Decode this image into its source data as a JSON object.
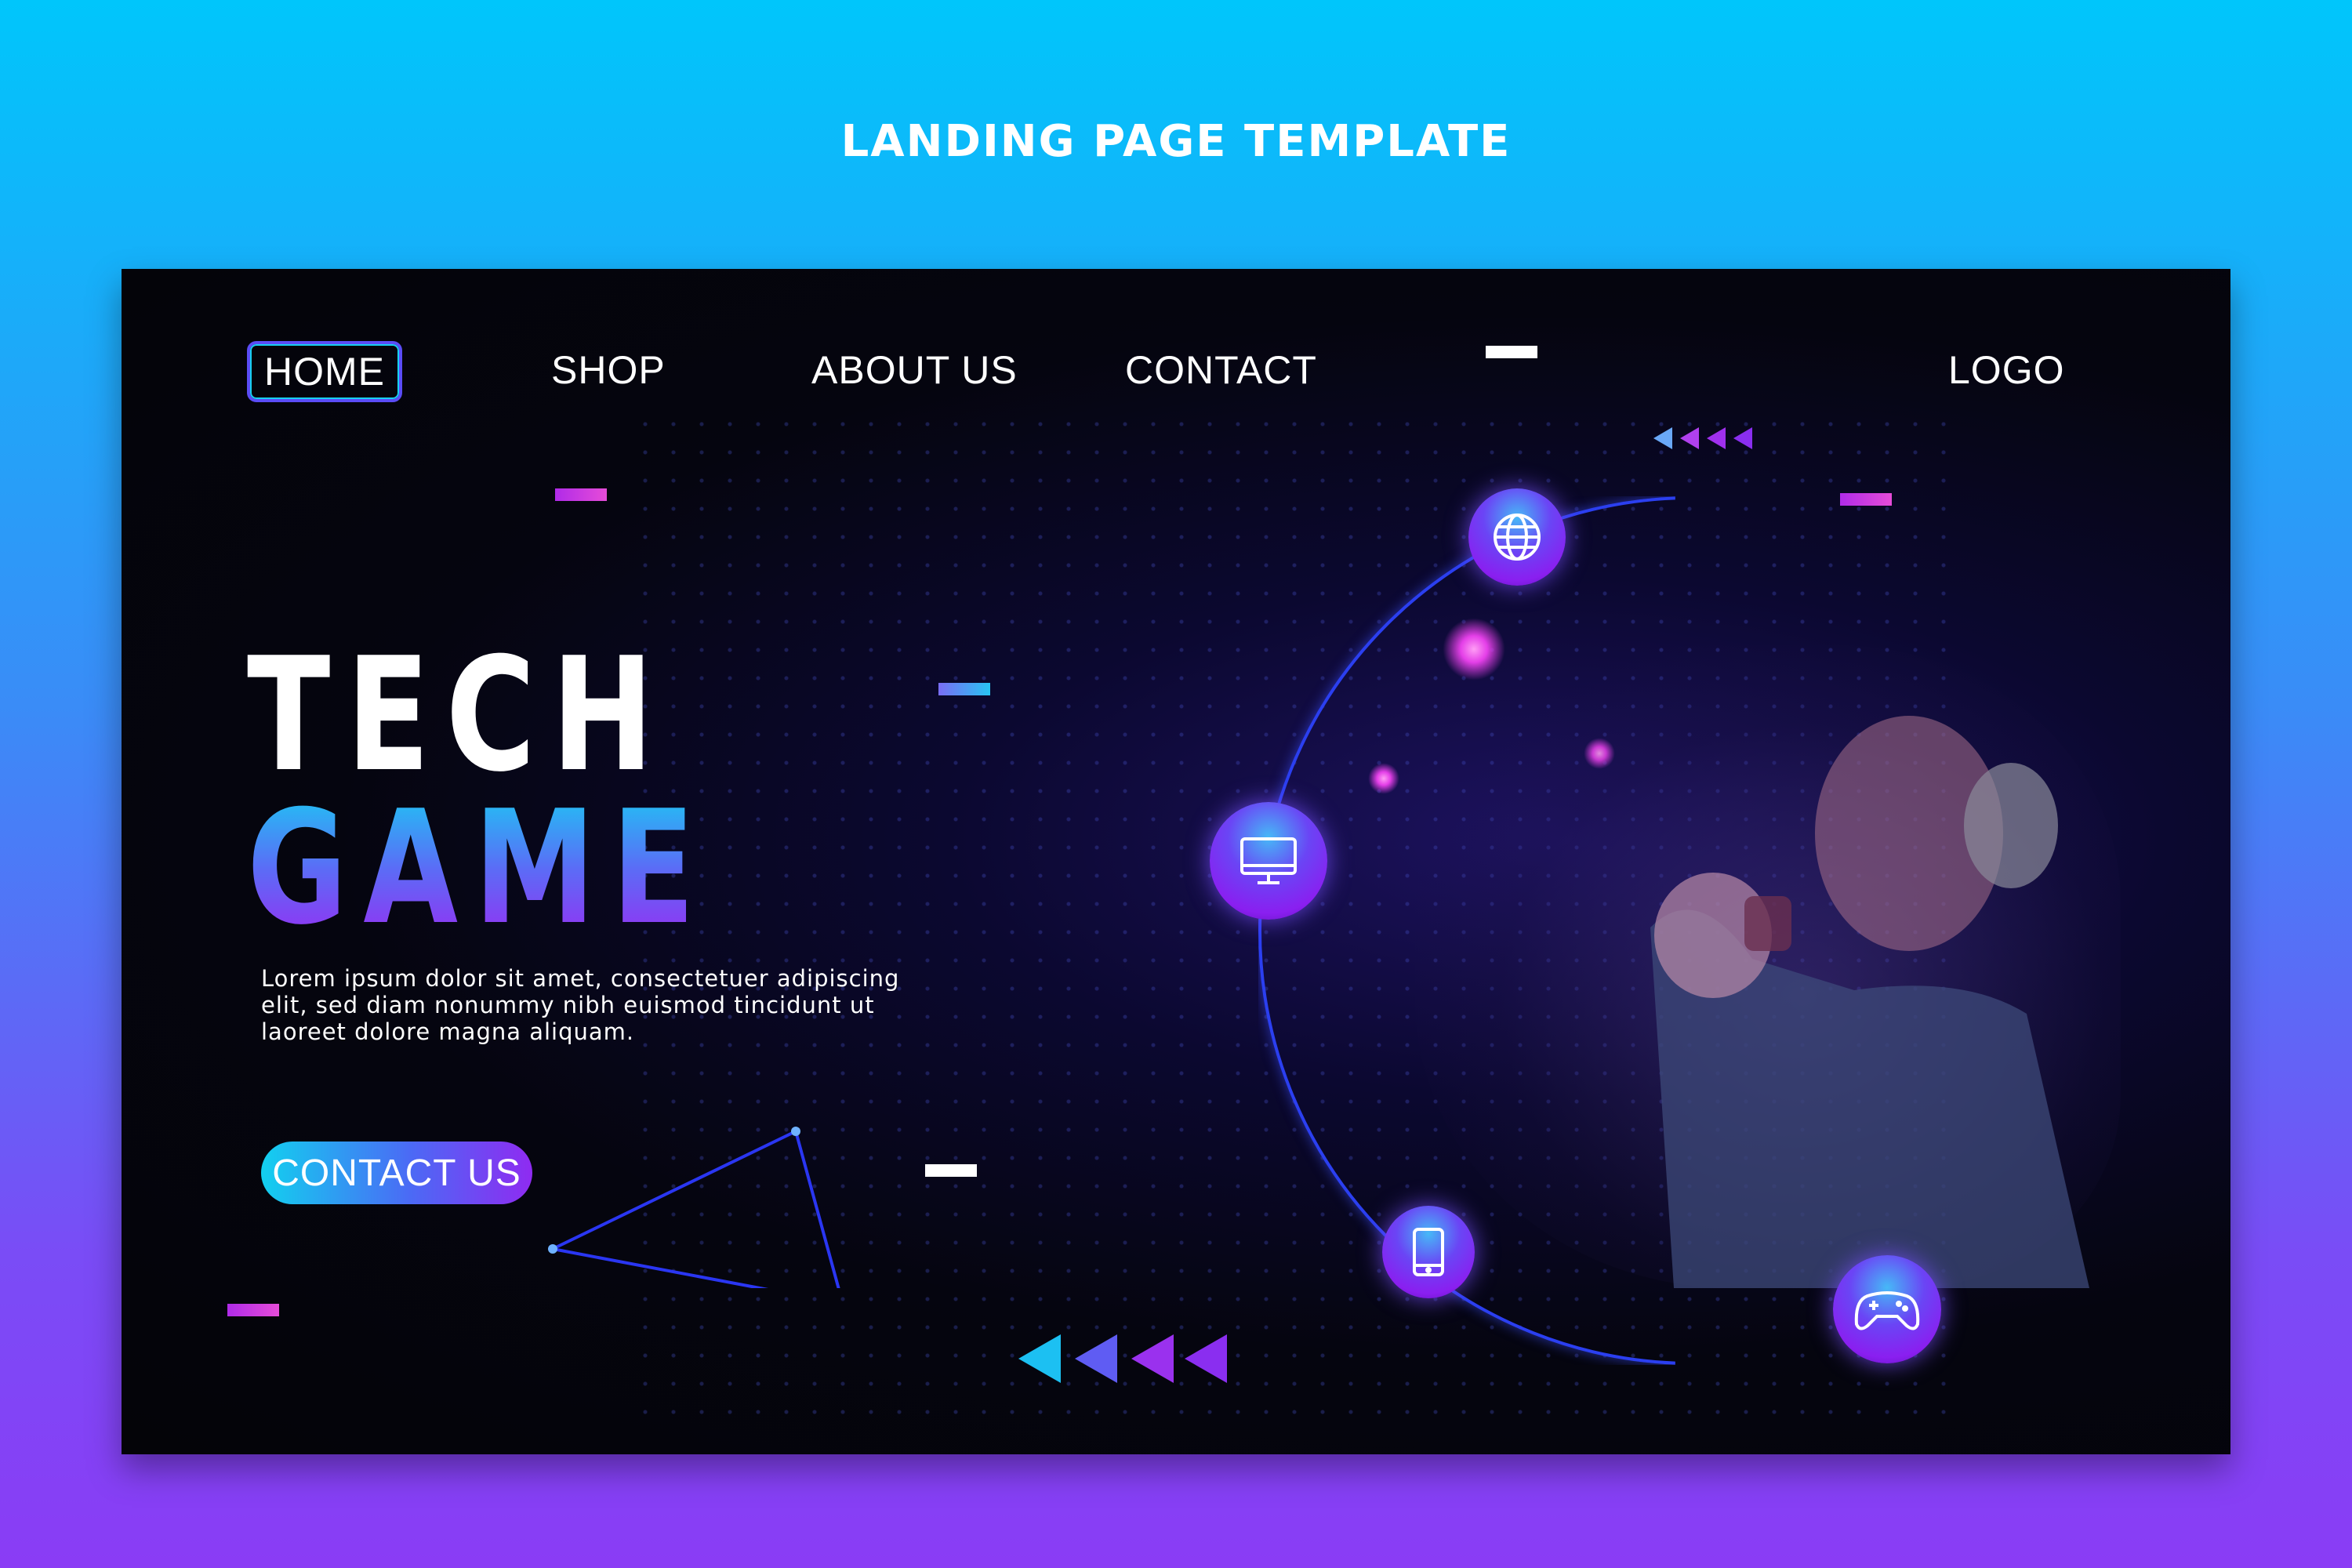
{
  "page": {
    "heading": "LANDING PAGE TEMPLATE"
  },
  "nav": {
    "items": [
      {
        "label": "HOME",
        "active": true
      },
      {
        "label": "SHOP"
      },
      {
        "label": "ABOUT US"
      },
      {
        "label": "CONTACT"
      }
    ],
    "logo": "LOGO"
  },
  "hero": {
    "title_line1": "TECH",
    "title_line2": "GAME",
    "description_lines": [
      "Lorem ipsum dolor sit amet, consectetuer adipiscing",
      "elit, sed diam nonummy nibh euismod tincidunt ut",
      "laoreet dolore magna aliquam."
    ],
    "cta_label": "CONTACT US"
  },
  "icons": {
    "orbit": [
      "globe-icon",
      "monitor-icon",
      "tablet-icon",
      "gamepad-icon"
    ],
    "decor": [
      "arrow-left-icon"
    ]
  },
  "colors": {
    "accent_cyan": "#12d0ef",
    "accent_blue": "#4b6af5",
    "accent_purple": "#8f2bf1",
    "accent_magenta": "#e43fe8",
    "panel_bg": "#05050f"
  }
}
